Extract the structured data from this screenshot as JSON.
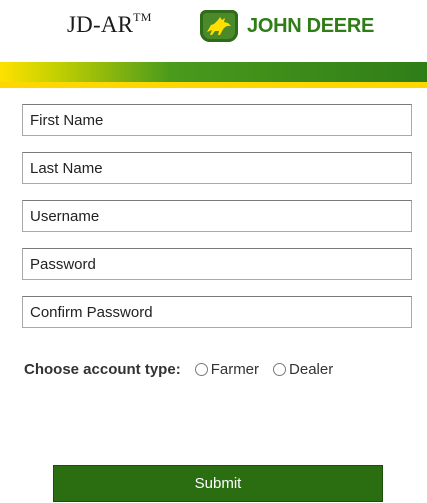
{
  "header": {
    "app_title": "JD-AR",
    "trademark": "TM",
    "brand_name": "JOHN DEERE",
    "logo_icon": "deer-logo-icon"
  },
  "colors": {
    "brand_green": "#2e7d16",
    "brand_yellow": "#ffd700",
    "submit_bg": "#2b6e12"
  },
  "form": {
    "first_name_placeholder": "First Name",
    "last_name_placeholder": "Last Name",
    "username_placeholder": "Username",
    "password_placeholder": "Password",
    "confirm_password_placeholder": "Confirm Password"
  },
  "account_type": {
    "label": "Choose account type:",
    "options": [
      "Farmer",
      "Dealer"
    ]
  },
  "submit_label": "Submit"
}
